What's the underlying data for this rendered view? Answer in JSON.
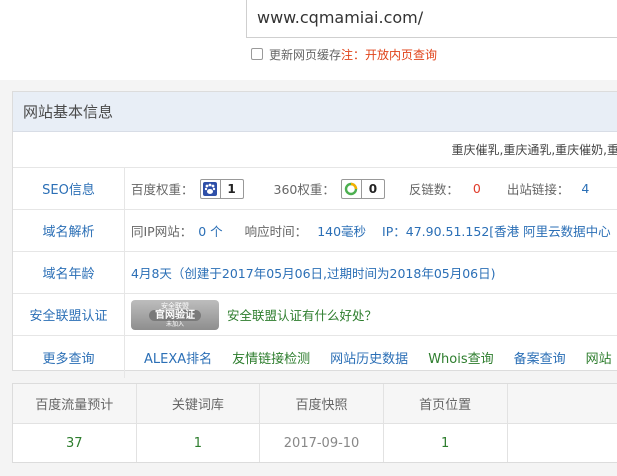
{
  "search": {
    "url_value": "www.cqmamiai.com/",
    "refresh_label": "更新网页缓存",
    "note": "注：开放内页查询"
  },
  "panel": {
    "title": "网站基本信息",
    "keywords": "重庆催乳,重庆通乳,重庆催奶,重庆"
  },
  "seo": {
    "label": "SEO信息",
    "baidu_weight_label": "百度权重：",
    "baidu_weight_value": "1",
    "w360_label": "360权重：",
    "w360_value": "0",
    "backlinks_label": "反链数：",
    "backlinks_value": "0",
    "outlinks_label": "出站链接：",
    "outlinks_value": "4"
  },
  "dns": {
    "label": "域名解析",
    "same_ip_label": "同IP网站：",
    "same_ip_value": "0 个",
    "response_label": "响应时间：",
    "response_value": "140毫秒",
    "ip_text": "IP：47.90.51.152[香港 阿里云数据中心"
  },
  "age": {
    "label": "域名年龄",
    "value": "4月8天（创建于2017年05月06日,过期时间为2018年05月06日)"
  },
  "security": {
    "label": "安全联盟认证",
    "seal_top": "安全联盟",
    "seal_main": "官网验证",
    "seal_bottom": "未加入",
    "link": "安全联盟认证有什么好处？"
  },
  "more": {
    "label": "更多查询",
    "links": [
      "ALEXA排名",
      "友情链接检测",
      "网站历史数据",
      "Whois查询",
      "备案查询",
      "网站"
    ]
  },
  "stats": {
    "headers": [
      "百度流量预计",
      "关键词库",
      "百度快照",
      "首页位置",
      ""
    ],
    "values": [
      "37",
      "1",
      "2017-09-10",
      "1",
      ""
    ]
  },
  "colors": {
    "link_blue": "#2b6fb6",
    "alert_red": "#e03b2a",
    "green": "#2d7d2d",
    "header_bg": "#e8eef6"
  }
}
